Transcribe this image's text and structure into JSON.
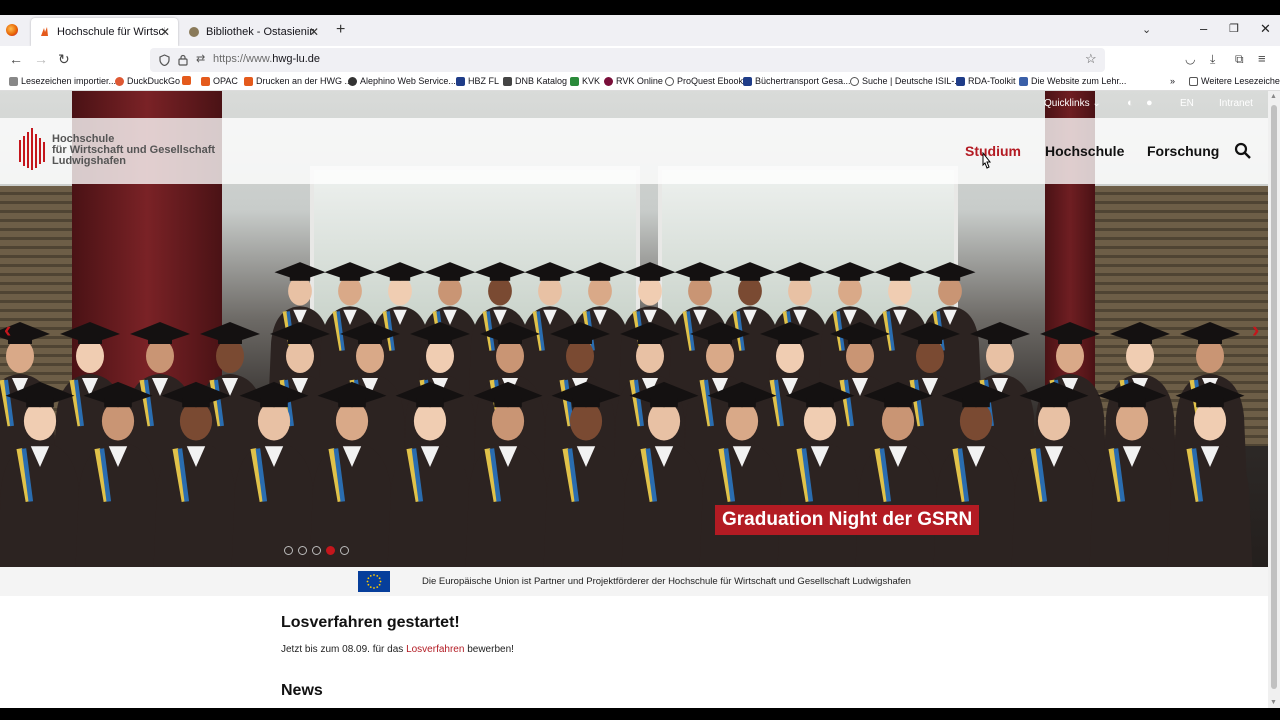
{
  "browser": {
    "tabs": [
      {
        "title": "Hochschule für Wirtschaft und"
      },
      {
        "title": "Bibliothek - Ostasieninstitut"
      }
    ],
    "url_dim": "https://www.",
    "url_main": "hwg-lu.de",
    "bookmarks": [
      "Lesezeichen importier...",
      "DuckDuckGo",
      "OPAC",
      "Drucken an der HWG ...",
      "Alephino Web Service...",
      "HBZ FL",
      "DNB Katalog",
      "KVK",
      "RVK Online",
      "ProQuest Ebook",
      "Büchertransport Gesa...",
      "Suche | Deutsche ISIL-...",
      "RDA-Toolkit",
      "Die Website zum Lehr...",
      "Weitere Lesezeichen"
    ]
  },
  "site": {
    "topbar": {
      "quicklinks": "Quicklinks",
      "lang": "EN",
      "intranet": "Intranet"
    },
    "logo": {
      "line1": "Hochschule",
      "line2": "für Wirtschaft und Gesellschaft",
      "line3": "Ludwigshafen"
    },
    "nav": [
      "Studium",
      "Hochschule",
      "Forschung"
    ],
    "slider": {
      "caption": "Graduation Night der GSRN",
      "active_slide": 4,
      "slide_count": 5
    },
    "eu_text": "Die Europäische Union ist Partner und Projektförderer der Hochschule für Wirtschaft und Gesellschaft Ludwigshafen",
    "notice": {
      "title": "Losverfahren gestartet!",
      "text_before": "Jetzt bis zum 08.09. für das ",
      "link": "Losverfahren",
      "text_after": " bewerben!"
    },
    "news_title": "News"
  },
  "colors": {
    "brand_red": "#b31b23",
    "eu_blue": "#063e9b"
  }
}
